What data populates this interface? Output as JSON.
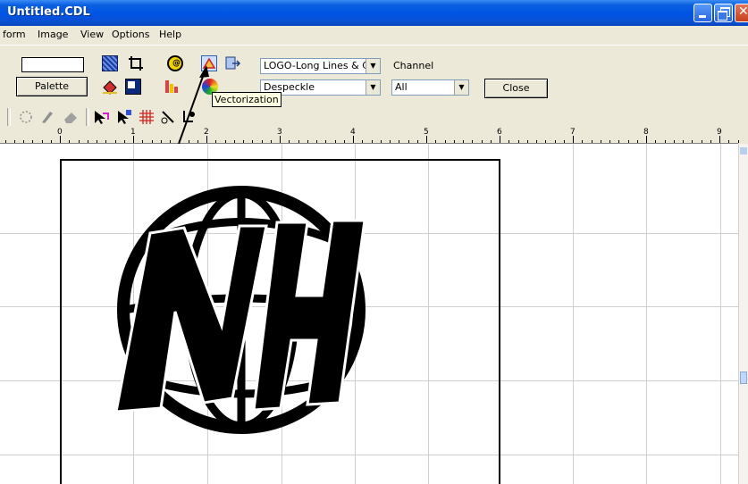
{
  "window": {
    "title": "Untitled.CDL",
    "minimize_icon": "minimize-icon",
    "restore_icon": "restore-icon",
    "close_icon": "close-icon"
  },
  "menu": {
    "items": [
      "form",
      "Image",
      "View",
      "Options",
      "Help"
    ]
  },
  "toolbar": {
    "palette_label": "Palette",
    "vector_preset": "LOGO-Long Lines & C",
    "filter": "Despeckle",
    "channel_label": "Channel",
    "channel_value": "All",
    "close_label": "Close",
    "tooltip": "Vectorization"
  },
  "ruler": {
    "labels": [
      "0",
      "1",
      "2",
      "3",
      "4",
      "5",
      "6",
      "7",
      "8",
      "9"
    ]
  },
  "colors": {
    "titlebar": "#0054e3",
    "face": "#ece9d8",
    "grid": "#cfcfcf",
    "tooltip": "#ffffe1"
  }
}
